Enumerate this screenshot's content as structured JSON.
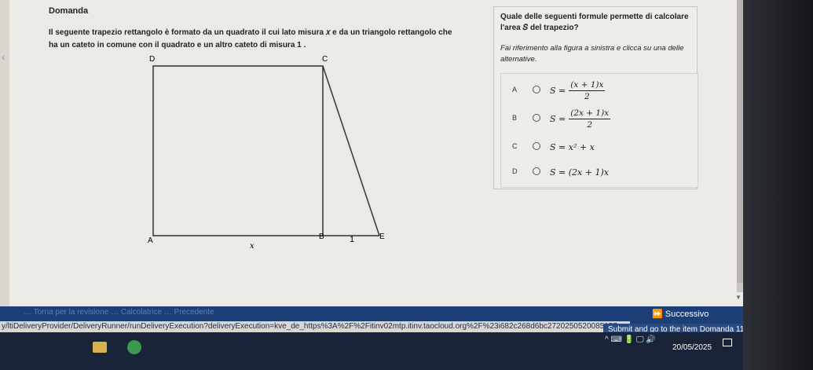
{
  "page": {
    "header": "Domanda",
    "question_line1": "Il seguente trapezio rettangolo è formato da un quadrato il cui lato misura 𝑥 e da un triangolo rettangolo che",
    "question_line2": "ha un cateto in comune con il quadrato e un altro cateto di misura 1 ."
  },
  "figure": {
    "labels": {
      "D": "D",
      "C": "C",
      "A": "A",
      "B": "B",
      "E": "E",
      "x": "𝑥",
      "one": "1"
    }
  },
  "right_panel": {
    "title": "Quale delle seguenti formule permette di calcolare l'area 𝑆  del trapezio?",
    "instructions": "Fai riferimento alla figura a sinistra e clicca su una delle alternative."
  },
  "options": [
    {
      "letter": "A",
      "lhs": "S =",
      "num": "(x + 1)x",
      "den": "2"
    },
    {
      "letter": "B",
      "lhs": "S =",
      "num": "(2x + 1)x",
      "den": "2"
    },
    {
      "letter": "C",
      "formula": "S = x² + x"
    },
    {
      "letter": "D",
      "formula": "S = (2x + 1)x"
    }
  ],
  "nav": {
    "next_label": "Successivo",
    "next_icon": "fast-forward-icon",
    "faded_text": "… Torna per la revisione … Calcolatrice … Precedente"
  },
  "status": {
    "url": "y/ltiDeliveryProvider/DeliveryRunner/runDeliveryExecution?deliveryExecution=kve_de_https%3A%2F%2Fitinv02mtp.itinv.taocloud.org%2F%23i682c268d6bc2720250520085157",
    "tooltip": "Submit and go to the item Domanda 11"
  },
  "taskbar": {
    "date": "20/05/2025",
    "tray_icons": "^  ⌨  🔋  🖵  🔊"
  },
  "colors": {
    "nav_bar": "#1c3f78",
    "taskbar": "#1a2438"
  }
}
